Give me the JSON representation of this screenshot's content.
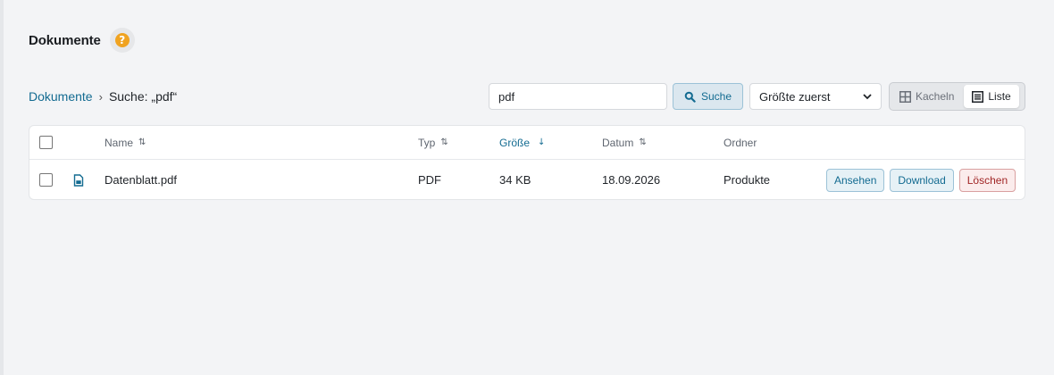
{
  "page": {
    "title": "Dokumente"
  },
  "help": {
    "label": "?"
  },
  "breadcrumb": {
    "root": "Dokumente",
    "separator": "›",
    "current": "Suche: „pdf“"
  },
  "search": {
    "value": "pdf",
    "button_label": "Suche"
  },
  "sort": {
    "selected": "Größte zuerst"
  },
  "view_toggle": {
    "tiles_label": "Kacheln",
    "list_label": "Liste",
    "active": "list"
  },
  "table": {
    "headers": {
      "name": "Name",
      "type": "Typ",
      "size": "Größe",
      "date": "Datum",
      "folder": "Ordner",
      "sortable_indicator": "⇅",
      "active_sort_indicator": "↓"
    },
    "rows": [
      {
        "name": "Datenblatt.pdf",
        "type": "PDF",
        "size": "34 KB",
        "date": "18.09.2026",
        "folder": "Produkte",
        "actions": {
          "view": "Ansehen",
          "download": "Download",
          "delete": "Löschen"
        }
      }
    ]
  },
  "colors": {
    "accent": "#136b91",
    "help": "#f0a321",
    "danger": "#a12626",
    "background": "#f3f4f6"
  }
}
